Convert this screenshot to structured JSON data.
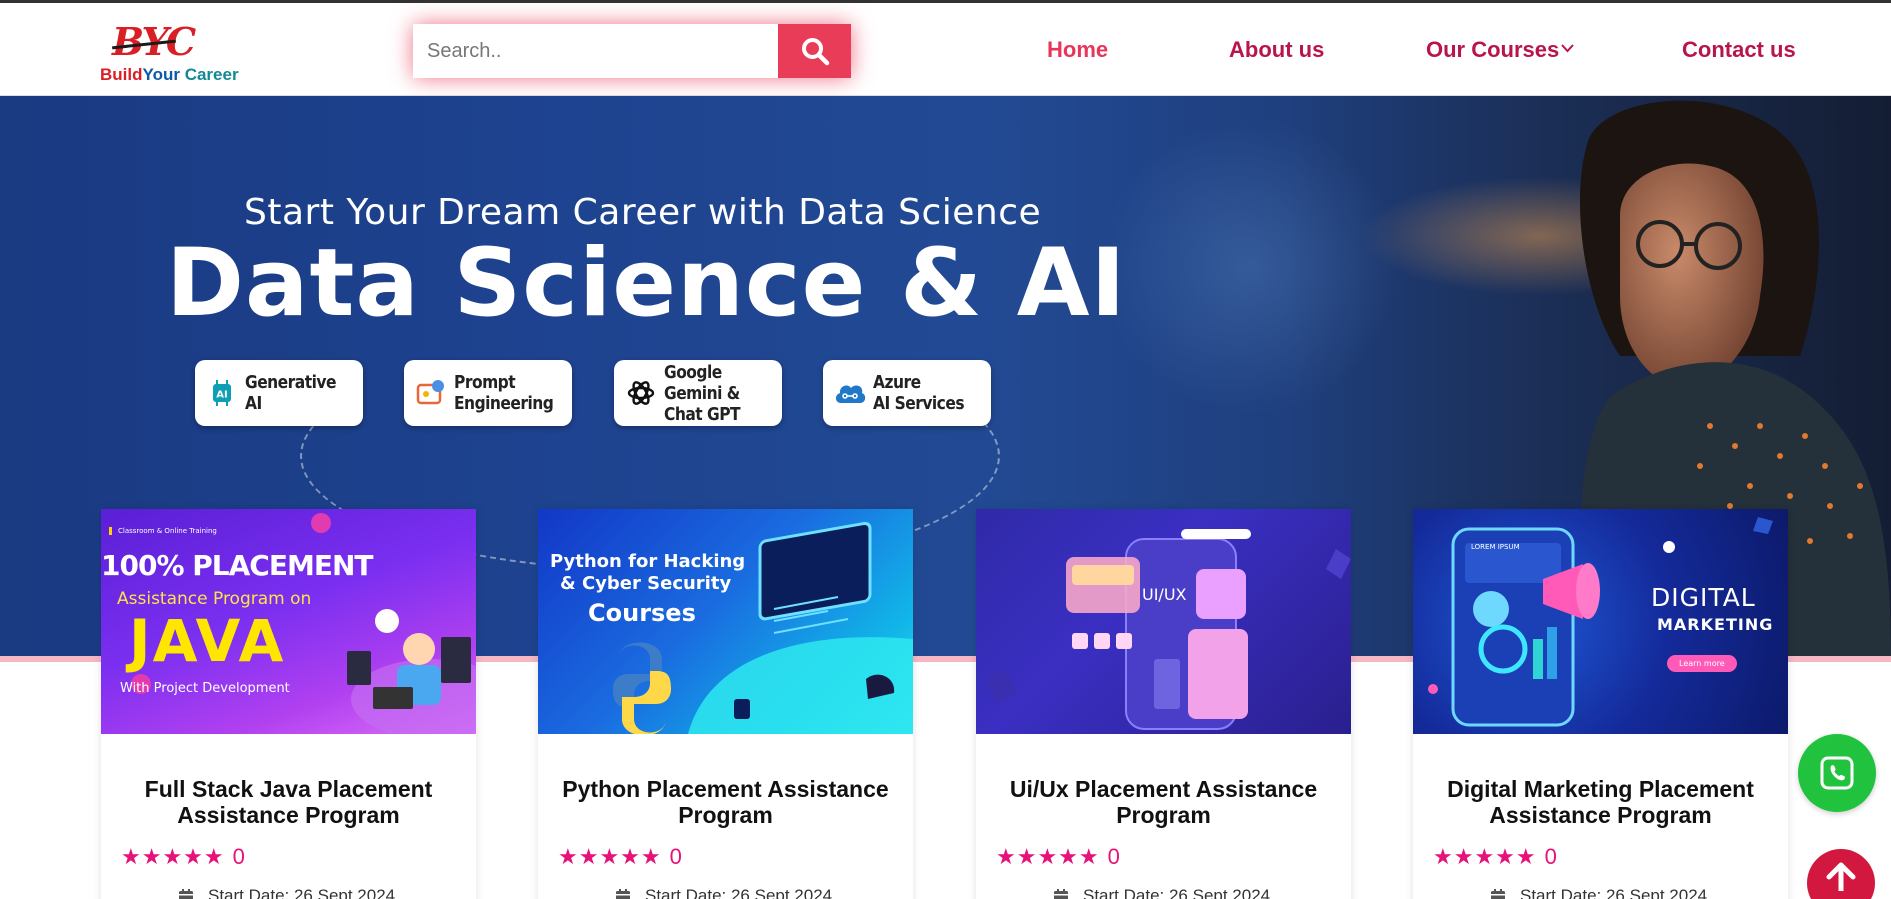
{
  "brand": {
    "mark": "BYC",
    "name_part1": "Build",
    "name_part2": "Your",
    "name_part3": "Career"
  },
  "search": {
    "placeholder": "Search..",
    "button_icon": "search-icon"
  },
  "nav": {
    "home": "Home",
    "about": "About us",
    "courses": "Our Courses",
    "contact": "Contact us",
    "active": "Home"
  },
  "hero": {
    "subtitle": "Start Your Dream Career with Data Science",
    "title": "Data Science & AI",
    "pills": [
      {
        "label": "Generative AI",
        "icon": "ai-chip-icon"
      },
      {
        "label": "Prompt\nEngineering",
        "icon": "prompt-icon"
      },
      {
        "label": "Google Gemini &\nChat GPT",
        "icon": "openai-icon"
      },
      {
        "label": "Azure\nAI Services",
        "icon": "cloud-brain-icon"
      }
    ]
  },
  "courses": [
    {
      "title": "Full Stack Java Placement Assistance Program",
      "stars": "★★★★★",
      "rating_count": "0",
      "start_date": "Start Date: 26 Sept 2024",
      "art": {
        "tag": "Classroom & Online Training",
        "line1": "100% PLACEMENT",
        "line2": "Assistance Program on",
        "line3": "JAVA",
        "line4": "With Project Development"
      }
    },
    {
      "title": "Python Placement Assistance Program",
      "stars": "★★★★★",
      "rating_count": "0",
      "start_date": "Start Date: 26 Sept 2024",
      "art": {
        "line1": "Python for Hacking",
        "line2": "& Cyber Security",
        "line3": "Courses"
      }
    },
    {
      "title": "Ui/Ux Placement Assistance Program",
      "stars": "★★★★★",
      "rating_count": "0",
      "start_date": "Start Date: 26 Sept 2024",
      "art": {
        "line1": "UI/UX"
      }
    },
    {
      "title": "Digital Marketing Placement Assistance Program",
      "stars": "★★★★★",
      "rating_count": "0",
      "start_date": "Start Date: 26 Sept 2024",
      "art": {
        "line1": "DIGITAL",
        "line2": "MARKETING",
        "line3": "Learn more",
        "line4": "LOREM IPSUM"
      }
    }
  ],
  "floating": {
    "whatsapp_icon": "whatsapp-icon",
    "back_to_top_icon": "arrow-up-icon"
  },
  "colors": {
    "accent": "#e83c58",
    "nav": "#b8154a",
    "star": "#e6127a",
    "whatsapp": "#21c23d"
  }
}
